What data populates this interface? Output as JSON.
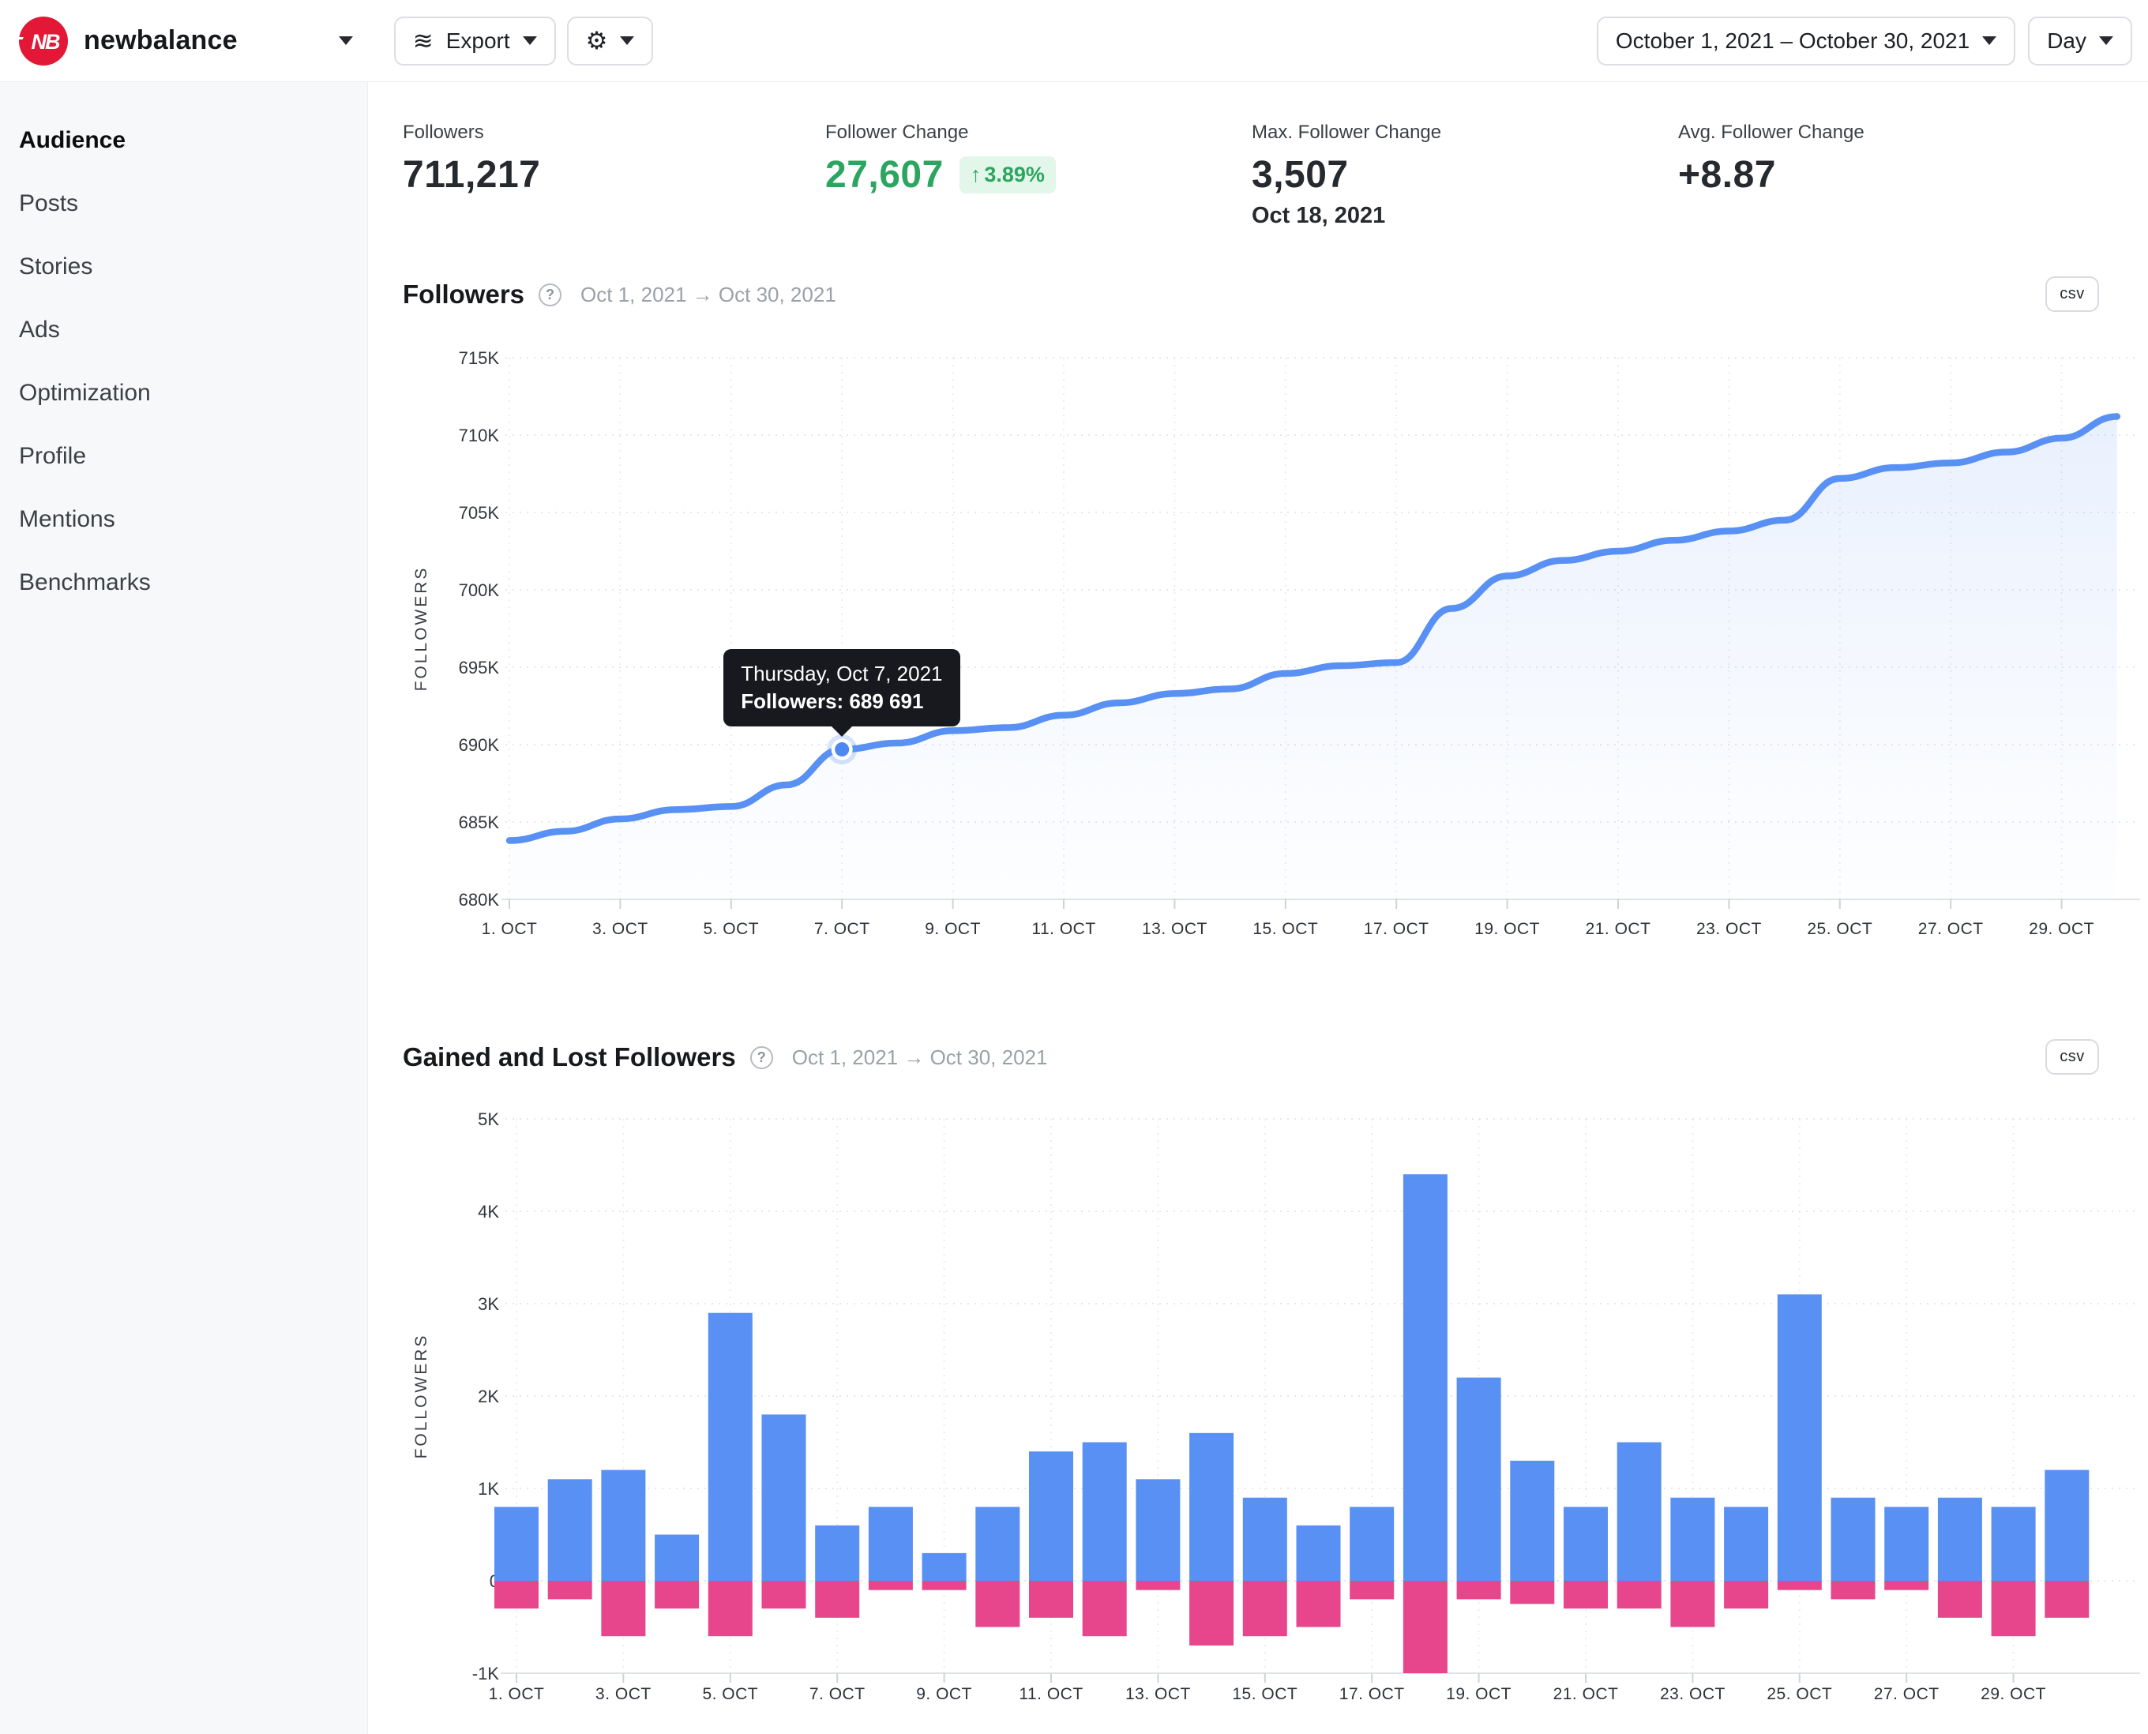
{
  "topbar": {
    "brand": "newbalance",
    "export_label": "Export",
    "date_range_label": "October 1, 2021 – October 30, 2021",
    "granularity_label": "Day"
  },
  "sidebar": {
    "items": [
      {
        "label": "Audience",
        "active": true
      },
      {
        "label": "Posts",
        "active": false
      },
      {
        "label": "Stories",
        "active": false
      },
      {
        "label": "Ads",
        "active": false
      },
      {
        "label": "Optimization",
        "active": false
      },
      {
        "label": "Profile",
        "active": false
      },
      {
        "label": "Mentions",
        "active": false
      },
      {
        "label": "Benchmarks",
        "active": false
      }
    ]
  },
  "stats": [
    {
      "label": "Followers",
      "value": "711,217"
    },
    {
      "label": "Follower Change",
      "value": "27,607",
      "badge_arrow": "↑",
      "badge": "3.89%"
    },
    {
      "label": "Max. Follower Change",
      "value": "3,507",
      "subvalue": "Oct 18, 2021"
    },
    {
      "label": "Avg. Follower Change",
      "value": "+8.87"
    }
  ],
  "sections": {
    "followers": {
      "title": "Followers",
      "date_range": "Oct 1, 2021 → Oct 30, 2021",
      "csv_label": "csv"
    },
    "gained_lost": {
      "title": "Gained and Lost Followers",
      "date_range": "Oct 1, 2021 → Oct 30, 2021",
      "csv_label": "csv"
    }
  },
  "chart_data": [
    {
      "type": "line",
      "title": "Followers",
      "xlabel": "",
      "ylabel": "FOLLOWERS",
      "categories": [
        "Oct 1",
        "Oct 2",
        "Oct 3",
        "Oct 4",
        "Oct 5",
        "Oct 6",
        "Oct 7",
        "Oct 8",
        "Oct 9",
        "Oct 10",
        "Oct 11",
        "Oct 12",
        "Oct 13",
        "Oct 14",
        "Oct 15",
        "Oct 16",
        "Oct 17",
        "Oct 18",
        "Oct 19",
        "Oct 20",
        "Oct 21",
        "Oct 22",
        "Oct 23",
        "Oct 24",
        "Oct 25",
        "Oct 26",
        "Oct 27",
        "Oct 28",
        "Oct 29",
        "Oct 30"
      ],
      "values": [
        683800,
        684400,
        685200,
        685800,
        686000,
        687400,
        689691,
        690100,
        690900,
        691100,
        691900,
        692700,
        693300,
        693600,
        694600,
        695100,
        695300,
        698800,
        700900,
        701900,
        702500,
        703200,
        703800,
        704500,
        707200,
        707900,
        708200,
        708900,
        709800,
        711200
      ],
      "ylim": [
        680000,
        715000
      ],
      "ytick_values": [
        715000,
        710000,
        705000,
        700000,
        695000,
        690000,
        685000,
        680000
      ],
      "ytick_labels": [
        "715K",
        "710K",
        "705K",
        "700K",
        "695K",
        "690K",
        "685K",
        "680K"
      ],
      "xtick_labels": [
        "1. OCT",
        "3. OCT",
        "5. OCT",
        "7. OCT",
        "9. OCT",
        "11. OCT",
        "13. OCT",
        "15. OCT",
        "17. OCT",
        "19. OCT",
        "21. OCT",
        "23. OCT",
        "25. OCT",
        "27. OCT",
        "29. OCT"
      ],
      "grid": true,
      "legend": "none",
      "tooltip": {
        "day_index": 6,
        "title": "Thursday, Oct 7, 2021",
        "value_label": "Followers: 689 691"
      }
    },
    {
      "type": "bar",
      "title": "Gained and Lost Followers",
      "xlabel": "",
      "ylabel": "FOLLOWERS",
      "categories": [
        "Oct 1",
        "Oct 2",
        "Oct 3",
        "Oct 4",
        "Oct 5",
        "Oct 6",
        "Oct 7",
        "Oct 8",
        "Oct 9",
        "Oct 10",
        "Oct 11",
        "Oct 12",
        "Oct 13",
        "Oct 14",
        "Oct 15",
        "Oct 16",
        "Oct 17",
        "Oct 18",
        "Oct 19",
        "Oct 20",
        "Oct 21",
        "Oct 22",
        "Oct 23",
        "Oct 24",
        "Oct 25",
        "Oct 26",
        "Oct 27",
        "Oct 28",
        "Oct 29",
        "Oct 30"
      ],
      "series": [
        {
          "name": "Gained Followers",
          "color": "#5890F4",
          "values": [
            800,
            1100,
            1200,
            500,
            2900,
            1800,
            600,
            800,
            300,
            800,
            1400,
            1500,
            1100,
            1600,
            900,
            600,
            800,
            4400,
            2200,
            1300,
            800,
            1500,
            900,
            800,
            3100,
            900,
            800,
            900,
            800,
            1200
          ]
        },
        {
          "name": "Lost Followers",
          "color": "#E8468C",
          "values": [
            -300,
            -200,
            -600,
            -300,
            -600,
            -300,
            -400,
            -100,
            -100,
            -500,
            -400,
            -600,
            -100,
            -700,
            -600,
            -500,
            -200,
            -1000,
            -200,
            -250,
            -300,
            -300,
            -500,
            -300,
            -100,
            -200,
            -100,
            -400,
            -600,
            -400
          ]
        }
      ],
      "ylim": [
        -1000,
        5000
      ],
      "ytick_values": [
        5000,
        4000,
        3000,
        2000,
        1000,
        0,
        -1000
      ],
      "ytick_labels": [
        "5K",
        "4K",
        "3K",
        "2K",
        "1K",
        "0",
        "-1K"
      ],
      "xtick_labels": [
        "1. OCT",
        "3. OCT",
        "5. OCT",
        "7. OCT",
        "9. OCT",
        "11. OCT",
        "13. OCT",
        "15. OCT",
        "17. OCT",
        "19. OCT",
        "21. OCT",
        "23. OCT",
        "25. OCT",
        "27. OCT",
        "29. OCT"
      ],
      "grid": true,
      "legend": "none"
    }
  ],
  "colors": {
    "accent_blue": "#5890F4",
    "accent_pink": "#E8468C",
    "green": "#2BA55F",
    "green_badge_bg": "#E2F6EA",
    "tooltip_bg": "#17191E",
    "brand_red": "#E21836",
    "grid_line": "#E4E7EB",
    "axis_line": "#DFE2E6"
  }
}
